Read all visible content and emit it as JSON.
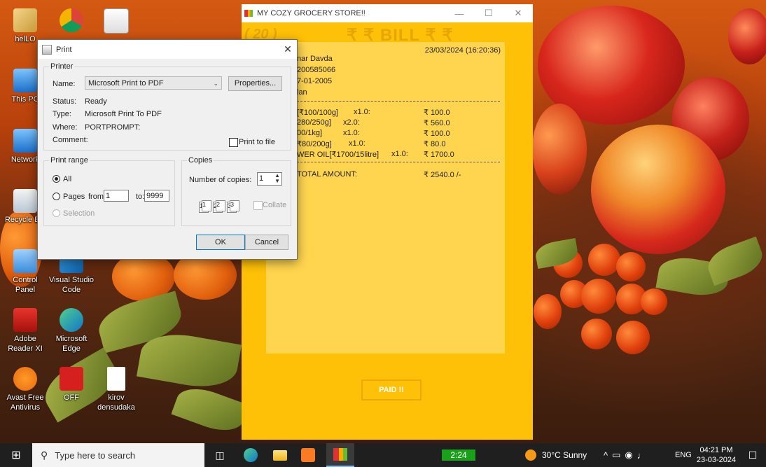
{
  "desktop": {
    "icons": [
      {
        "label": "helLO"
      },
      {
        "label": ""
      },
      {
        "label": ""
      },
      {
        "label": "This PC"
      },
      {
        "label": "Network"
      },
      {
        "label": "Recycle Bin"
      },
      {
        "label": "Control Panel"
      },
      {
        "label": "Visual Studio Code"
      },
      {
        "label": "Adobe Reader XI"
      },
      {
        "label": "Microsoft Edge"
      },
      {
        "label": "Avast Free Antivirus"
      },
      {
        "label": "OFF"
      },
      {
        "label": "kirov densudaka"
      }
    ]
  },
  "grocery_app": {
    "window_title": "MY COZY GROCERY STORE!!",
    "bill_number": "( 20 )",
    "bill_title": "₹ ₹ BILL ₹ ₹",
    "datetime": "23/03/2024 (16:20:36)",
    "customer_lines": [
      "nar Davda",
      "200585066",
      "7-01-2005",
      "lan"
    ],
    "items": [
      {
        "name": "[₹100/100g]",
        "qty": "x1.0:",
        "amount": "₹ 100.0"
      },
      {
        "name": "280/250g]",
        "qty": "x2.0:",
        "amount": "₹ 560.0"
      },
      {
        "name": "00/1kg]",
        "qty": "x1.0:",
        "amount": "₹ 100.0"
      },
      {
        "name": "₹80/200g]",
        "qty": "x1.0:",
        "amount": "₹ 80.0"
      },
      {
        "name": "WER OIL[₹1700/15litre]",
        "qty": "x1.0:",
        "amount": "₹ 1700.0"
      }
    ],
    "total_label": "TOTAL AMOUNT:",
    "total_value": "₹ 2540.0 /-",
    "paid_button": "PAID !!"
  },
  "print_dialog": {
    "title": "Print",
    "printer_group": "Printer",
    "name_label": "Name:",
    "printer_name": "Microsoft Print to PDF",
    "properties_button": "Properties...",
    "status_label": "Status:",
    "status_value": "Ready",
    "type_label": "Type:",
    "type_value": "Microsoft Print To PDF",
    "where_label": "Where:",
    "where_value": "PORTPROMPT:",
    "comment_label": "Comment:",
    "print_to_file": "Print to file",
    "range_group": "Print range",
    "all_label": "All",
    "pages_label": "Pages",
    "from_label": "from:",
    "from_value": "1",
    "to_label": "to:",
    "to_value": "9999",
    "selection_label": "Selection",
    "copies_group": "Copies",
    "copies_label": "Number of copies:",
    "copies_value": "1",
    "collate_label": "Collate",
    "ok_button": "OK",
    "cancel_button": "Cancel"
  },
  "taskbar": {
    "search_placeholder": "Type here to search",
    "timer_label": "2:24",
    "weather": "30°C  Sunny",
    "language": "ENG",
    "time": "04:21 PM",
    "date": "23-03-2024"
  },
  "colors": {
    "app_yellow": "#ffc107",
    "receipt_yellow": "#ffd54f",
    "taskbar": "#1f1f1f"
  }
}
